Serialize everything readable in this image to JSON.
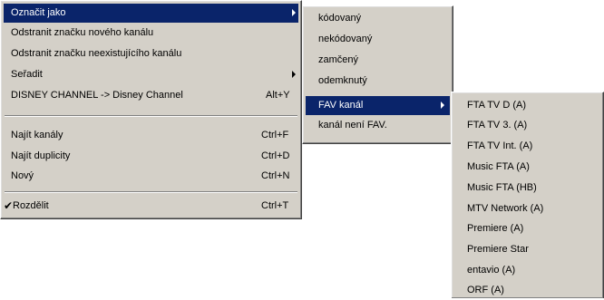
{
  "menu_main": {
    "items": [
      {
        "label": "Označit jako",
        "shortcut": "",
        "submenu": true
      },
      {
        "label": "Odstranit značku nového kanálu",
        "shortcut": "",
        "submenu": false
      },
      {
        "label": "Odstranit značku neexistujícího kanálu",
        "shortcut": "",
        "submenu": false
      },
      {
        "label": "Seřadit",
        "shortcut": "",
        "submenu": true
      },
      {
        "label": "DISNEY CHANNEL -> Disney Channel",
        "shortcut": "Alt+Y",
        "submenu": false
      },
      {
        "label": "Najít kanály",
        "shortcut": "Ctrl+F",
        "submenu": false
      },
      {
        "label": "Najít duplicity",
        "shortcut": "Ctrl+D",
        "submenu": false
      },
      {
        "label": "Nový",
        "shortcut": "Ctrl+N",
        "submenu": false
      },
      {
        "label": "Rozdělit",
        "shortcut": "Ctrl+T",
        "submenu": false,
        "checked": true
      }
    ],
    "check_mark": "✔"
  },
  "menu_mark_as": {
    "items": [
      {
        "label": "kódovaný"
      },
      {
        "label": "nekódovaný"
      },
      {
        "label": "zamčený"
      },
      {
        "label": "odemknutý"
      },
      {
        "label": "FAV kanál",
        "submenu": true
      },
      {
        "label": "kanál není FAV."
      }
    ]
  },
  "menu_fav": {
    "items": [
      {
        "label": "FTA TV D (A)"
      },
      {
        "label": "FTA TV 3. (A)"
      },
      {
        "label": "FTA TV Int. (A)"
      },
      {
        "label": "Music FTA (A)"
      },
      {
        "label": "Music FTA (HB)"
      },
      {
        "label": "MTV Network (A)"
      },
      {
        "label": "Premiere (A)"
      },
      {
        "label": "Premiere Star"
      },
      {
        "label": "entavio (A)"
      },
      {
        "label": "ORF (A)"
      }
    ]
  },
  "colors": {
    "menu_background": "#d4d0c8",
    "highlight": "#0a246a",
    "highlight_text": "#ffffff"
  }
}
